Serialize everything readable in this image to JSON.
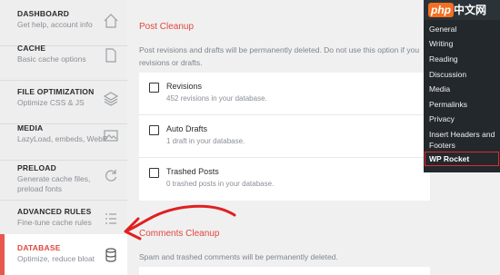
{
  "sidebar": {
    "items": [
      {
        "title": "DASHBOARD",
        "subtitle": "Get help, account info",
        "icon": "home-icon"
      },
      {
        "title": "CACHE",
        "subtitle": "Basic cache options",
        "icon": "file-icon"
      },
      {
        "title": "FILE OPTIMIZATION",
        "subtitle": "Optimize CSS & JS",
        "icon": "layers-icon"
      },
      {
        "title": "MEDIA",
        "subtitle": "LazyLoad, embeds, WebP",
        "icon": "image-icon"
      },
      {
        "title": "PRELOAD",
        "subtitle": "Generate cache files, preload fonts",
        "icon": "refresh-icon"
      },
      {
        "title": "ADVANCED RULES",
        "subtitle": "Fine-tune cache rules",
        "icon": "list-icon"
      },
      {
        "title": "DATABASE",
        "subtitle": "Optimize, reduce bloat",
        "icon": "database-icon"
      }
    ]
  },
  "main": {
    "post_cleanup": {
      "title": "Post Cleanup",
      "description": "Post revisions and drafts will be permanently deleted. Do not use this option if you revisions or drafts.",
      "options": [
        {
          "label": "Revisions",
          "detail": "452 revisions in your database.",
          "checked": false
        },
        {
          "label": "Auto Drafts",
          "detail": "1 draft in your database.",
          "checked": false
        },
        {
          "label": "Trashed Posts",
          "detail": "0 trashed posts in your database.",
          "checked": false
        }
      ]
    },
    "comments_cleanup": {
      "title": "Comments Cleanup",
      "description": "Spam and trashed comments will be permanently deleted."
    }
  },
  "wp_menu": {
    "watermark": {
      "badge": "php",
      "text": "中文网"
    },
    "items": [
      "General",
      "Writing",
      "Reading",
      "Discussion",
      "Media",
      "Permalinks",
      "Privacy",
      "Insert Headers and Footers"
    ],
    "active": "WP Rocket"
  },
  "colors": {
    "accent": "#e0473e",
    "wp_menu_bg": "#23282d",
    "highlight_box": "#e02b2b"
  }
}
